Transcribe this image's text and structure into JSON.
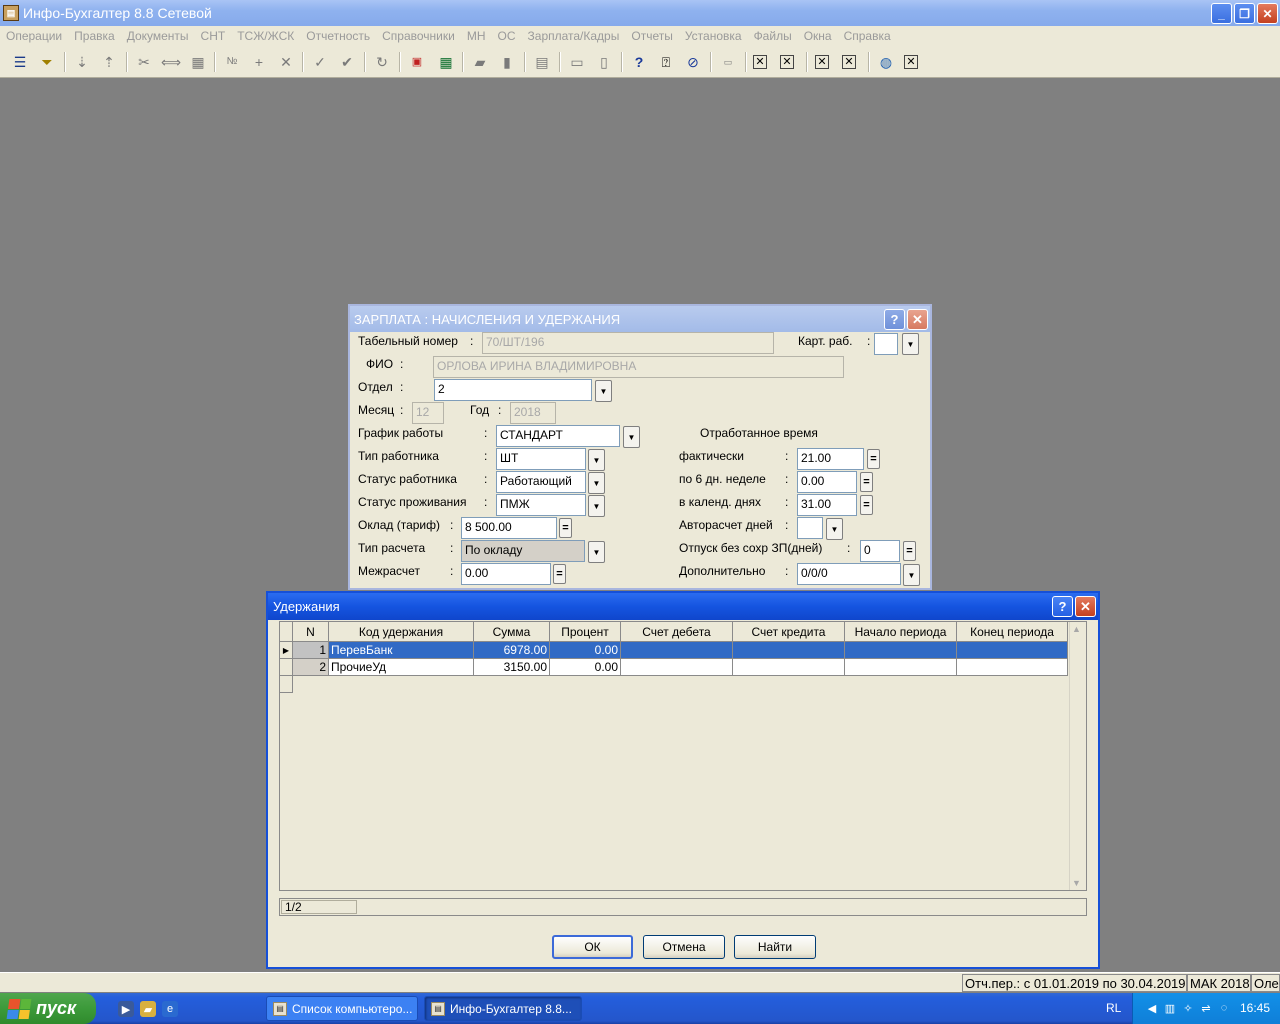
{
  "app": {
    "title": "Инфо-Бухгалтер 8.8 Сетевой",
    "icon": "app-book-icon"
  },
  "menu": [
    "Операции",
    "Правка",
    "Документы",
    "СНТ",
    "ТСЖ/ЖСК",
    "Отчетность",
    "Справочники",
    "МН",
    "ОС",
    "Зарплата/Кадры",
    "Отчеты",
    "Установка",
    "Файлы",
    "Окна",
    "Справка"
  ],
  "toolbar_icons": [
    "list-icon",
    "filter-icon",
    "sort-asc-icon",
    "sort-desc-icon",
    "cut-icon",
    "split-icon",
    "paste-icon",
    "numbering-icon",
    "add-icon",
    "delete-icon",
    "mark-icon",
    "mark-all-icon",
    "refresh-icon",
    "pdf-icon",
    "calculator-icon",
    "open-folder-icon",
    "save-icon",
    "report-icon",
    "print-icon",
    "document-icon",
    "help-icon",
    "context-help-icon",
    "compass-icon",
    "export-icon",
    "close-x-icon",
    "close-x-icon",
    "close-x-icon",
    "close-x-icon",
    "globe-icon",
    "close-x-icon"
  ],
  "salary_dialog": {
    "title": "ЗАРПЛАТА : НАЧИСЛЕНИЯ И УДЕРЖАНИЯ",
    "tab_number_label": "Табельный номер",
    "tab_number": "70/ШТ/196",
    "card_label": "Карт. раб.",
    "card_value": "",
    "fio_label": "ФИО",
    "fio": "ОРЛОВА ИРИНА ВЛАДИМИРОВНА",
    "dept_label": "Отдел",
    "dept": "2",
    "month_label": "Месяц",
    "month": "12",
    "year_label": "Год",
    "year": "2018",
    "schedule_label": "График работы",
    "schedule": "СТАНДАРТ",
    "worker_type_label": "Тип работника",
    "worker_type": "ШТ",
    "worker_status_label": "Статус работника",
    "worker_status": "Работающий",
    "residence_label": "Статус проживания",
    "residence": "ПМЖ",
    "salary_label": "Оклад (тариф)",
    "salary": "8 500.00",
    "calc_type_label": "Тип расчета",
    "calc_type": "По окладу",
    "intercalc_label": "Межрасчет",
    "intercalc": "0.00",
    "worked_time_header": "Отработанное время",
    "actual_label": "фактически",
    "actual": "21.00",
    "six_day_label": "по 6 дн. неделе",
    "six_day": "0.00",
    "calendar_label": "в календ. днях",
    "calendar": "31.00",
    "autocalc_label": "Авторасчет дней",
    "autocalc": "",
    "unpaid_label": "Отпуск без сохр ЗП(дней)",
    "unpaid": "0",
    "additional_label": "Дополнительно",
    "additional": "0/0/0"
  },
  "deductions_dialog": {
    "title": "Удержания",
    "columns": [
      "N",
      "Код удержания",
      "Сумма",
      "Процент",
      "Счет дебета",
      "Счет кредита",
      "Начало периода",
      "Конец периода"
    ],
    "rows": [
      {
        "n": "1",
        "code": "ПеревБанк",
        "sum": "6978.00",
        "percent": "0.00",
        "debit": "",
        "credit": "",
        "start": "",
        "end": ""
      },
      {
        "n": "2",
        "code": "ПрочиеУд",
        "sum": "3150.00",
        "percent": "0.00",
        "debit": "",
        "credit": "",
        "start": "",
        "end": ""
      }
    ],
    "position": "1/2",
    "ok_label": "ОК",
    "cancel_label": "Отмена",
    "find_label": "Найти"
  },
  "statusbar": {
    "period": "Отч.пер.: с 01.01.2019 по 30.04.2019",
    "version": "МАК 2018",
    "user": "Оле"
  },
  "taskbar": {
    "start_label": "пуск",
    "tasks": [
      "Список компьютеро...",
      "Инфо-Бухгалтер 8.8..."
    ],
    "lang": "RL",
    "clock": "16:45"
  },
  "colors": {
    "desktop": "#808080",
    "dialog_face": "#ece9d8",
    "selection": "#316ac5",
    "active_title": "#1554e0"
  }
}
